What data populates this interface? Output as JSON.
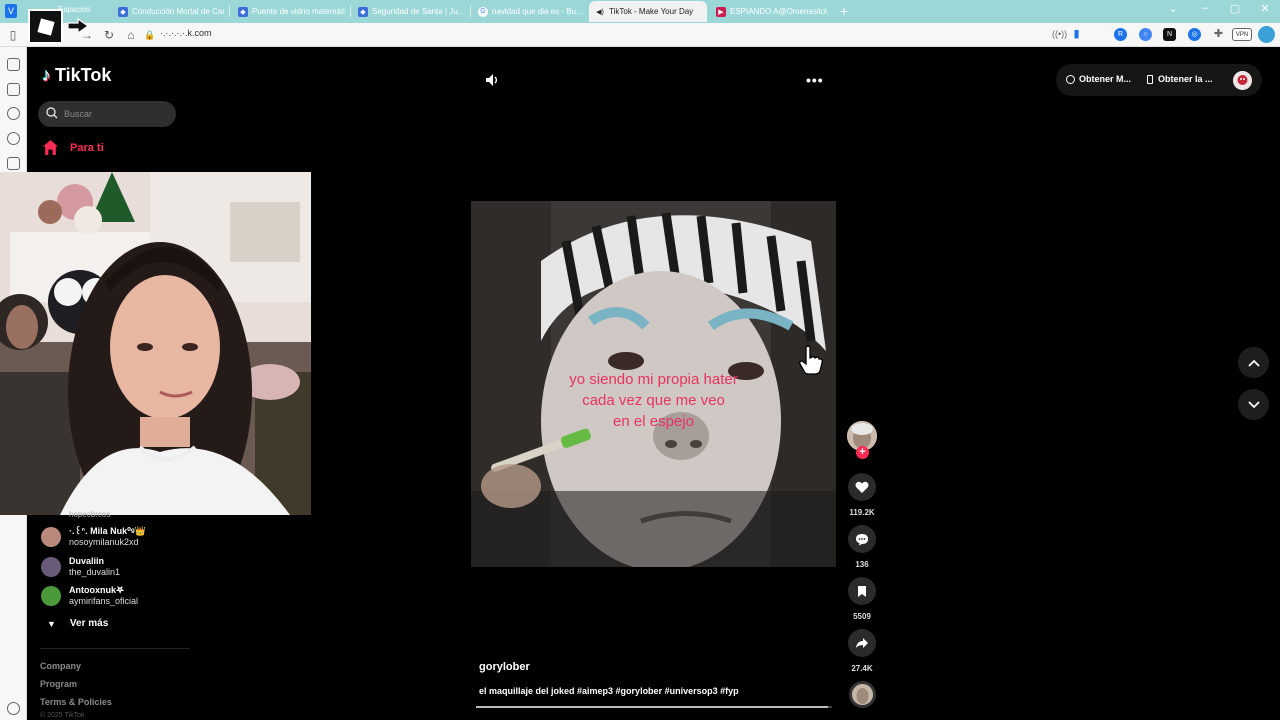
{
  "browser": {
    "spaces_label": "Espacios",
    "tabs": [
      {
        "title": "Conducción Mortal de Car",
        "fav_color": "#3b6fd6"
      },
      {
        "title": "Puente de vidrio matemáti",
        "fav_color": "#3b6fd6"
      },
      {
        "title": "Seguridad de Santa | Juego",
        "fav_color": "#3b6fd6"
      },
      {
        "title": "navidad que dia es - Busca",
        "fav_color": "#ffffff"
      },
      {
        "title": "TikTok - Make Your Day",
        "fav_color": "#222222"
      },
      {
        "title": "ESPIANDO A@Omenasito\\",
        "fav_color": "#c81e4f"
      }
    ],
    "url": "tiktok.com",
    "url_display": "·.·.·.·.·.k.com",
    "extensions": [
      {
        "name": "wifi-icon",
        "color": "#888888"
      },
      {
        "name": "bookmark-icon",
        "color": "#1a73e8"
      },
      {
        "name": "extension-r-icon",
        "color": "#1a73e8"
      },
      {
        "name": "extension-search-icon",
        "color": "#4285f4"
      },
      {
        "name": "notion-icon",
        "color": "#111111"
      },
      {
        "name": "extension-blue-icon",
        "color": "#1a73e8"
      },
      {
        "name": "puzzle-icon",
        "color": "#666666"
      },
      {
        "name": "vpn-icon",
        "color": "#ffffff"
      },
      {
        "name": "profile-icon",
        "color": "#3aa0d8"
      }
    ],
    "vpn_label": "VPN"
  },
  "sidebar": {
    "logo_text": "TikTok",
    "search_placeholder": "Buscar",
    "for_you_label": "Para ti",
    "cut_text": "hopecbrcos",
    "following": [
      {
        "display_name": "·.꒰ᐢ. Mila Nuk⁰ᵍ👑",
        "username": "nosoymilanuk2xd",
        "avatar_color": "#b98a7c"
      },
      {
        "display_name": "Duvaliin",
        "username": "the_duvalin1",
        "avatar_color": "#6a5a7a"
      },
      {
        "display_name": "Antooxnuk𖤐",
        "username": "aymirifans_oficial",
        "avatar_color": "#4a9a3a"
      }
    ],
    "see_more_label": "Ver más",
    "footer_links": [
      "Company",
      "Program",
      "Terms & Policies"
    ],
    "copyright": "© 2025 TikTok"
  },
  "header": {
    "more_label": "•••",
    "get_coins_label": "Obtener M...",
    "get_app_label": "Obtener la ..."
  },
  "video": {
    "overlay_text_lines": [
      "yo siendo mi propia hater",
      "cada vez que me veo",
      "en el espejo"
    ],
    "author": "gorylober",
    "description": "el maquillaje del joked #aimep3 #gorylober #universop3 #fyp",
    "progress": 0.99
  },
  "actions": {
    "likes": "119.2K",
    "comments": "136",
    "saves": "5509",
    "shares": "27.4K"
  },
  "colors": {
    "accent": "#fe2c55",
    "tabbar": "#9ad7d6",
    "caption": "#e8345f"
  }
}
